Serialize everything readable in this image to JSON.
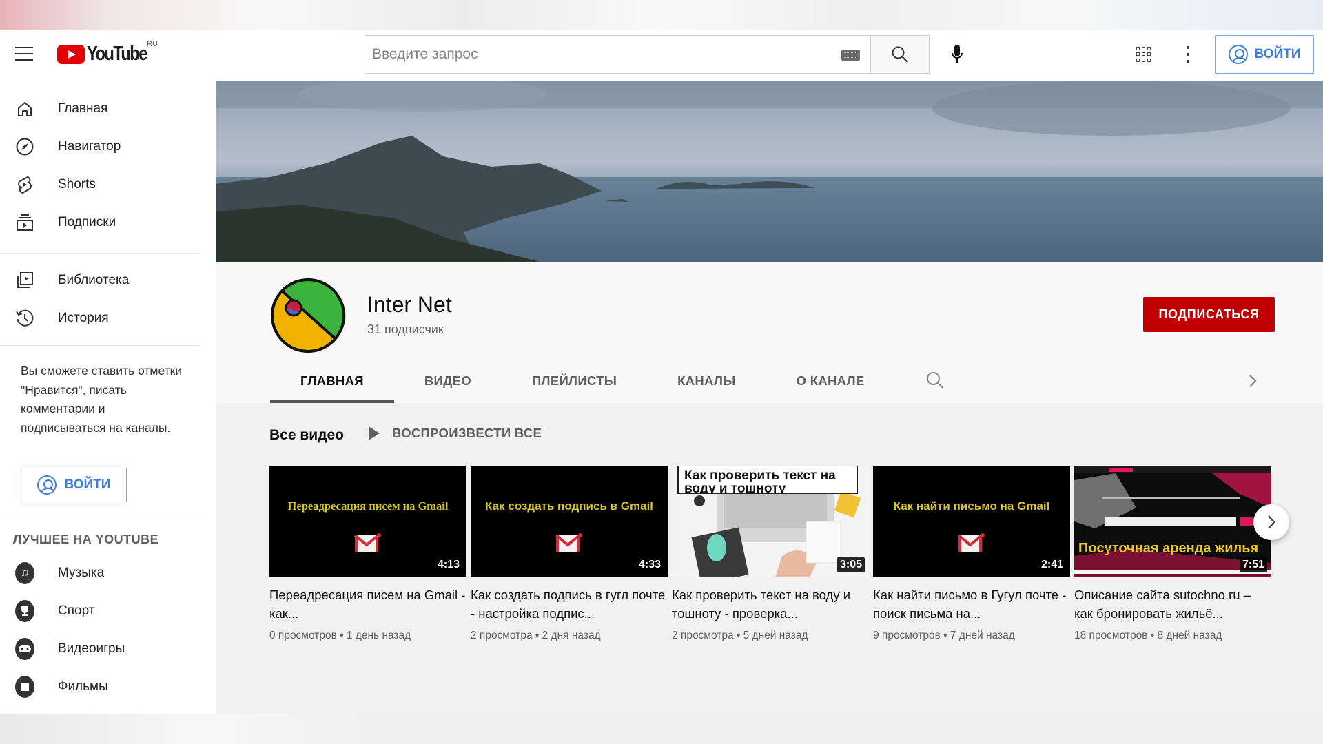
{
  "header": {
    "logo_text": "YouTube",
    "region": "RU",
    "search_placeholder": "Введите запрос",
    "search_value": "",
    "signin_label": "ВОЙТИ"
  },
  "sidebar": {
    "main_items": [
      {
        "label": "Главная",
        "icon": "home-icon"
      },
      {
        "label": "Навигатор",
        "icon": "compass-icon"
      },
      {
        "label": "Shorts",
        "icon": "shorts-icon"
      },
      {
        "label": "Подписки",
        "icon": "subscriptions-icon"
      }
    ],
    "library_items": [
      {
        "label": "Библиотека",
        "icon": "library-icon"
      },
      {
        "label": "История",
        "icon": "history-icon"
      }
    ],
    "signin_promo": "Вы сможете ставить отметки \"Нравится\", писать комментарии и подписываться на каналы.",
    "signin_label": "ВОЙТИ",
    "best_title": "ЛУЧШЕЕ НА YOUTUBE",
    "best_items": [
      {
        "label": "Музыка",
        "icon": "music-icon"
      },
      {
        "label": "Спорт",
        "icon": "trophy-icon"
      },
      {
        "label": "Видеоигры",
        "icon": "gamepad-icon"
      },
      {
        "label": "Фильмы",
        "icon": "film-icon"
      }
    ]
  },
  "channel": {
    "name": "Inter Net",
    "subscribers": "31 подписчик",
    "subscribe_label": "ПОДПИСАТЬСЯ",
    "tabs": [
      {
        "label": "ГЛАВНАЯ",
        "active": true
      },
      {
        "label": "ВИДЕО",
        "active": false
      },
      {
        "label": "ПЛЕЙЛИСТЫ",
        "active": false
      },
      {
        "label": "КАНАЛЫ",
        "active": false
      },
      {
        "label": "О КАНАЛЕ",
        "active": false
      }
    ]
  },
  "shelf": {
    "title": "Все видео",
    "play_all_label": "ВОСПРОИЗВЕСТИ ВСЕ",
    "videos": [
      {
        "thumb_text": "Переадресация писем на Gmail",
        "duration": "4:13",
        "title": "Переадресация писем на Gmail - как...",
        "meta": "0 просмотров • 1 день назад"
      },
      {
        "thumb_text": "Как создать подпись в Gmail",
        "duration": "4:33",
        "title": "Как создать подпись в гугл почте - настройка подпис...",
        "meta": "2 просмотра • 2 дня назад"
      },
      {
        "thumb_text": "Как проверить текст на воду и тошноту",
        "duration": "3:05",
        "title": "Как проверить текст на воду и тошноту - проверка...",
        "meta": "2 просмотра • 5 дней назад"
      },
      {
        "thumb_text": "Как найти письмо на Gmail",
        "duration": "2:41",
        "title": "Как найти письмо в Гугул почте - поиск письма на...",
        "meta": "9 просмотров • 7 дней назад"
      },
      {
        "thumb_text": "Посуточная аренда жилья",
        "duration": "7:51",
        "title": "Описание сайта sutochno.ru – как бронировать жильё...",
        "meta": "18 просмотров • 8 дней назад"
      }
    ]
  },
  "colors": {
    "brand_red": "#e00000",
    "subscribe_red": "#c00000",
    "link_blue": "#3d7fd9",
    "thumb_text_yellow": "#d8c22a"
  }
}
